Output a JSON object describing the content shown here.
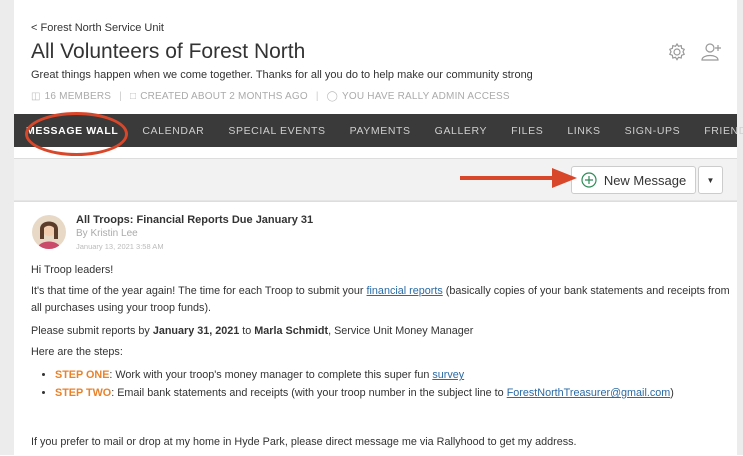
{
  "breadcrumb": "< Forest North Service Unit",
  "group": {
    "title": "All Volunteers of Forest North",
    "tagline": "Great things happen when we come together. Thanks for all you do to help make our community strong",
    "members": "16 MEMBERS",
    "created": "CREATED ABOUT 2 MONTHS AGO",
    "access": "YOU HAVE RALLY ADMIN ACCESS"
  },
  "header_icons": [
    "settings-gear-icon",
    "add-member-icon"
  ],
  "nav": [
    "MESSAGE WALL",
    "CALENDAR",
    "SPECIAL EVENTS",
    "PAYMENTS",
    "GALLERY",
    "FILES",
    "LINKS",
    "SIGN-UPS",
    "FRIENDS"
  ],
  "toolbar": {
    "new_message": "New Message"
  },
  "post": {
    "title": "All Troops: Financial Reports Due January 31",
    "author": "By Kristin Lee",
    "date": "January 13, 2021 3:58 AM",
    "greeting": "Hi Troop leaders!",
    "p1_a": "It's that time of the year again! The time for each Troop to submit your ",
    "p1_link": "financial reports",
    "p1_b": " (basically copies of your bank statements and receipts from all purchases using your troop funds).",
    "p2_a": "Please submit reports by ",
    "p2_date": "January 31, 2021",
    "p2_b": " to ",
    "p2_name": "Marla Schmidt",
    "p2_c": ", Service Unit Money Manager",
    "p3": "Here are the steps:",
    "step1_label": "STEP ONE",
    "step1_text": ": Work with your troop's money manager to complete this super fun ",
    "step1_link": "survey",
    "step2_label": "STEP TWO",
    "step2_text": ": Email bank statements and receipts (with your troop number in the subject line to ",
    "step2_link": "ForestNorthTreasurer@gmail.com",
    "step2_end": ")",
    "p4": "If you prefer to mail or drop at my home in Hyde Park, please direct message me via Rallyhood to get my address."
  },
  "colors": {
    "annotation": "#d9472b",
    "nav_bg": "#3a3a3a",
    "step_orange": "#e8822b",
    "link": "#2a6aa5"
  }
}
